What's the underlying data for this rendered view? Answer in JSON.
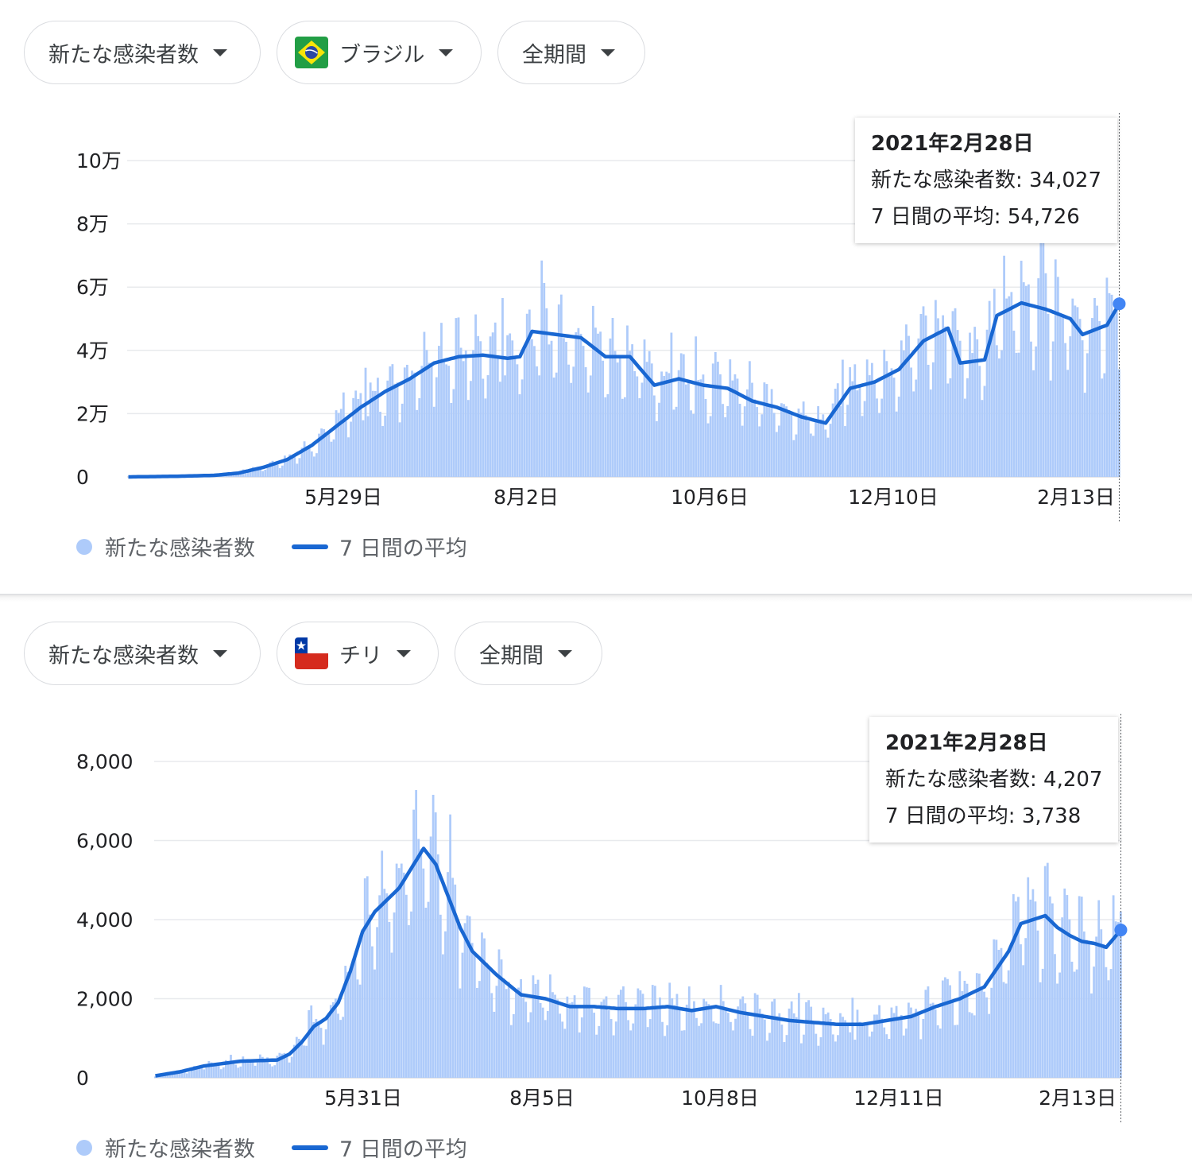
{
  "panels": [
    {
      "metric_selector": "新たな感染者数",
      "country_selector": "ブラジル",
      "period_selector": "全期間",
      "flag": "brazil-flag",
      "tooltip": {
        "date": "2021年2月28日",
        "cases": "新たな感染者数: 34,027",
        "avg": "7 日間の平均: 54,726"
      },
      "legend": {
        "bars": "新たな感染者数",
        "line": "7 日間の平均"
      }
    },
    {
      "metric_selector": "新たな感染者数",
      "country_selector": "チリ",
      "period_selector": "全期間",
      "flag": "chile-flag",
      "tooltip": {
        "date": "2021年2月28日",
        "cases": "新たな感染者数: 4,207",
        "avg": "7 日間の平均: 3,738"
      },
      "legend": {
        "bars": "新たな感染者数",
        "line": "7 日間の平均"
      }
    }
  ],
  "colors": {
    "bar": "#aecbfa",
    "line": "#1967d2",
    "grid": "#e8eaed",
    "dot": "#4285f4"
  },
  "chart_data": [
    {
      "type": "bar",
      "title": "",
      "combined_with": "line",
      "x_range": [
        "2020-02-26",
        "2021-02-28"
      ],
      "x_tick_labels": [
        "5月29日",
        "8月2日",
        "10月6日",
        "12月10日",
        "2月13日"
      ],
      "y_tick_labels": [
        "0",
        "2万",
        "4万",
        "6万",
        "8万",
        "10万"
      ],
      "ylim": [
        0,
        100000
      ],
      "grid": true,
      "legend_position": "bottom-left",
      "series": [
        {
          "name": "新たな感染者数",
          "type": "bar",
          "note": "daily values estimated from the 7-day average with weekly variation",
          "anchors": [
            [
              0,
              0
            ],
            [
              20,
              200
            ],
            [
              35,
              500
            ],
            [
              45,
              1200
            ],
            [
              55,
              3000
            ],
            [
              65,
              5500
            ],
            [
              75,
              10000
            ],
            [
              85,
              16000
            ],
            [
              95,
              22000
            ],
            [
              105,
              27000
            ],
            [
              115,
              31000
            ],
            [
              125,
              36000
            ],
            [
              135,
              38000
            ],
            [
              145,
              38500
            ],
            [
              155,
              37500
            ],
            [
              160,
              38000
            ],
            [
              165,
              46000
            ],
            [
              175,
              45000
            ],
            [
              185,
              44000
            ],
            [
              195,
              38000
            ],
            [
              205,
              38000
            ],
            [
              215,
              29000
            ],
            [
              225,
              31000
            ],
            [
              235,
              29000
            ],
            [
              245,
              28000
            ],
            [
              255,
              24000
            ],
            [
              265,
              22000
            ],
            [
              275,
              19000
            ],
            [
              285,
              17000
            ],
            [
              295,
              28000
            ],
            [
              305,
              30000
            ],
            [
              315,
              34000
            ],
            [
              325,
              43000
            ],
            [
              335,
              47000
            ],
            [
              340,
              36000
            ],
            [
              350,
              37000
            ],
            [
              355,
              51000
            ],
            [
              365,
              55000
            ],
            [
              375,
              53000
            ],
            [
              385,
              50000
            ],
            [
              390,
              45000
            ],
            [
              400,
              48000
            ],
            [
              405,
              54726
            ]
          ]
        },
        {
          "name": "7 日間の平均",
          "type": "line",
          "anchors": [
            [
              0,
              0
            ],
            [
              20,
              200
            ],
            [
              35,
              500
            ],
            [
              45,
              1200
            ],
            [
              55,
              3000
            ],
            [
              65,
              5500
            ],
            [
              75,
              10000
            ],
            [
              85,
              16000
            ],
            [
              95,
              22000
            ],
            [
              105,
              27000
            ],
            [
              115,
              31000
            ],
            [
              125,
              36000
            ],
            [
              135,
              38000
            ],
            [
              145,
              38500
            ],
            [
              155,
              37500
            ],
            [
              160,
              38000
            ],
            [
              165,
              46000
            ],
            [
              175,
              45000
            ],
            [
              185,
              44000
            ],
            [
              195,
              38000
            ],
            [
              205,
              38000
            ],
            [
              215,
              29000
            ],
            [
              225,
              31000
            ],
            [
              235,
              29000
            ],
            [
              245,
              28000
            ],
            [
              255,
              24000
            ],
            [
              265,
              22000
            ],
            [
              275,
              19000
            ],
            [
              285,
              17000
            ],
            [
              295,
              28000
            ],
            [
              305,
              30000
            ],
            [
              315,
              34000
            ],
            [
              325,
              43000
            ],
            [
              335,
              47000
            ],
            [
              340,
              36000
            ],
            [
              350,
              37000
            ],
            [
              355,
              51000
            ],
            [
              365,
              55000
            ],
            [
              375,
              53000
            ],
            [
              385,
              50000
            ],
            [
              390,
              45000
            ],
            [
              400,
              48000
            ],
            [
              405,
              54726
            ]
          ]
        }
      ],
      "last_point": {
        "date": "2021年2月28日",
        "cases": 34027,
        "avg": 54726
      }
    },
    {
      "type": "bar",
      "title": "",
      "combined_with": "line",
      "x_range": [
        "2020-03-04",
        "2021-02-28"
      ],
      "x_tick_labels": [
        "5月31日",
        "8月5日",
        "10月8日",
        "12月11日",
        "2月13日"
      ],
      "y_tick_labels": [
        "0",
        "2,000",
        "4,000",
        "6,000",
        "8,000"
      ],
      "ylim": [
        0,
        8000
      ],
      "grid": true,
      "legend_position": "bottom-left",
      "series": [
        {
          "name": "新たな感染者数",
          "type": "bar",
          "note": "daily values estimated from the 7-day average with weekly variation",
          "anchors": [
            [
              0,
              50
            ],
            [
              10,
              150
            ],
            [
              20,
              300
            ],
            [
              35,
              420
            ],
            [
              50,
              450
            ],
            [
              55,
              600
            ],
            [
              60,
              900
            ],
            [
              65,
              1300
            ],
            [
              70,
              1500
            ],
            [
              75,
              1900
            ],
            [
              80,
              2700
            ],
            [
              85,
              3700
            ],
            [
              90,
              4200
            ],
            [
              95,
              4500
            ],
            [
              100,
              4800
            ],
            [
              105,
              5300
            ],
            [
              110,
              5800
            ],
            [
              115,
              5400
            ],
            [
              120,
              4600
            ],
            [
              125,
              3800
            ],
            [
              130,
              3200
            ],
            [
              140,
              2600
            ],
            [
              150,
              2100
            ],
            [
              160,
              2000
            ],
            [
              170,
              1800
            ],
            [
              180,
              1800
            ],
            [
              190,
              1750
            ],
            [
              200,
              1750
            ],
            [
              210,
              1800
            ],
            [
              220,
              1700
            ],
            [
              230,
              1800
            ],
            [
              240,
              1650
            ],
            [
              250,
              1550
            ],
            [
              260,
              1450
            ],
            [
              270,
              1400
            ],
            [
              280,
              1350
            ],
            [
              290,
              1350
            ],
            [
              300,
              1450
            ],
            [
              310,
              1550
            ],
            [
              320,
              1800
            ],
            [
              330,
              2000
            ],
            [
              340,
              2300
            ],
            [
              350,
              3200
            ],
            [
              355,
              3900
            ],
            [
              360,
              4000
            ],
            [
              365,
              4100
            ],
            [
              370,
              3800
            ],
            [
              375,
              3600
            ],
            [
              380,
              3450
            ],
            [
              385,
              3400
            ],
            [
              390,
              3300
            ],
            [
              396,
              3738
            ]
          ]
        },
        {
          "name": "7 日間の平均",
          "type": "line",
          "anchors": [
            [
              0,
              50
            ],
            [
              10,
              150
            ],
            [
              20,
              300
            ],
            [
              35,
              420
            ],
            [
              50,
              450
            ],
            [
              55,
              600
            ],
            [
              60,
              900
            ],
            [
              65,
              1300
            ],
            [
              70,
              1500
            ],
            [
              75,
              1900
            ],
            [
              80,
              2700
            ],
            [
              85,
              3700
            ],
            [
              90,
              4200
            ],
            [
              95,
              4500
            ],
            [
              100,
              4800
            ],
            [
              105,
              5300
            ],
            [
              110,
              5800
            ],
            [
              115,
              5400
            ],
            [
              120,
              4600
            ],
            [
              125,
              3800
            ],
            [
              130,
              3200
            ],
            [
              140,
              2600
            ],
            [
              150,
              2100
            ],
            [
              160,
              2000
            ],
            [
              170,
              1800
            ],
            [
              180,
              1800
            ],
            [
              190,
              1750
            ],
            [
              200,
              1750
            ],
            [
              210,
              1800
            ],
            [
              220,
              1700
            ],
            [
              230,
              1800
            ],
            [
              240,
              1650
            ],
            [
              250,
              1550
            ],
            [
              260,
              1450
            ],
            [
              270,
              1400
            ],
            [
              280,
              1350
            ],
            [
              290,
              1350
            ],
            [
              300,
              1450
            ],
            [
              310,
              1550
            ],
            [
              320,
              1800
            ],
            [
              330,
              2000
            ],
            [
              340,
              2300
            ],
            [
              350,
              3200
            ],
            [
              355,
              3900
            ],
            [
              360,
              4000
            ],
            [
              365,
              4100
            ],
            [
              370,
              3800
            ],
            [
              375,
              3600
            ],
            [
              380,
              3450
            ],
            [
              385,
              3400
            ],
            [
              390,
              3300
            ],
            [
              396,
              3738
            ]
          ]
        }
      ],
      "last_point": {
        "date": "2021年2月28日",
        "cases": 4207,
        "avg": 3738
      }
    }
  ]
}
